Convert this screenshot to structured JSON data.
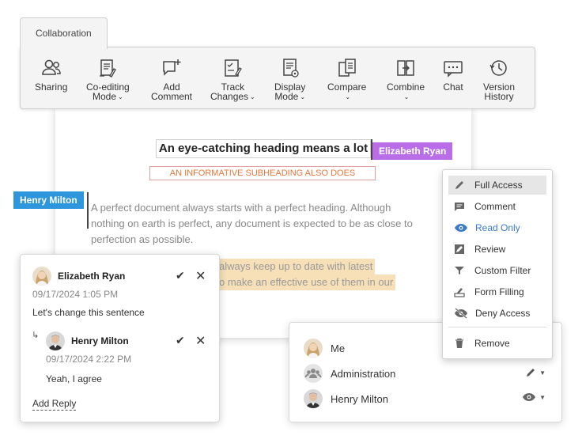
{
  "toolbar": {
    "tab_label": "Collaboration",
    "tools": [
      {
        "icon": "sharing-icon",
        "line1": "Sharing",
        "line2": "",
        "dropdown": false
      },
      {
        "icon": "co-editing-mode-icon",
        "line1": "Co-editing",
        "line2": "Mode",
        "dropdown": true
      },
      {
        "icon": "add-comment-icon",
        "line1": "Add",
        "line2": "Comment",
        "dropdown": false
      },
      {
        "icon": "track-changes-icon",
        "line1": "Track",
        "line2": "Changes",
        "dropdown": true
      },
      {
        "icon": "display-mode-icon",
        "line1": "Display",
        "line2": "Mode",
        "dropdown": true
      },
      {
        "icon": "compare-icon",
        "line1": "Compare",
        "line2": "",
        "dropdown": true
      },
      {
        "icon": "combine-icon",
        "line1": "Combine",
        "line2": "",
        "dropdown": true
      },
      {
        "icon": "chat-icon",
        "line1": "Chat",
        "line2": "",
        "dropdown": false
      },
      {
        "icon": "version-history-icon",
        "line1": "Version",
        "line2": "History",
        "dropdown": false
      }
    ]
  },
  "document": {
    "heading": "An eye-catching heading means a lot",
    "subheading": "AN INFORMATIVE SUBHEADING ALSO DOES",
    "cursor_elizabeth": "Elizabeth Ryan",
    "cursor_henry": "Henry Milton",
    "para_line1": "A perfect  document always starts with a perfect heading. Although",
    "para_line2": "nothing on earth is perfect, any document is expected to be as close to",
    "para_line3": "perfection as possible.",
    "highlight_line1": "always keep up to date with latest",
    "highlight_line2": "o make an effective use of them in our",
    "colors": {
      "elizabeth": "#b96ee8",
      "henry": "#2e96dd",
      "subheading": "#e8763c",
      "highlight": "#f7e0b8"
    }
  },
  "comments": {
    "main": {
      "author": "Elizabeth Ryan",
      "date": "09/17/2024 1:05 PM",
      "text": "Let's change this sentence"
    },
    "reply": {
      "author": "Henry Milton",
      "date": "09/17/2024 2:22 PM",
      "text": "Yeah, I agree"
    },
    "add_reply": "Add Reply"
  },
  "sharing": {
    "users": [
      {
        "name": "Me",
        "avatar": "woman-avatar",
        "permission_icon": ""
      },
      {
        "name": "Administration",
        "avatar": "group-avatar",
        "permission_icon": "pencil-icon"
      },
      {
        "name": "Henry Milton",
        "avatar": "man-avatar",
        "permission_icon": "eye-icon"
      }
    ]
  },
  "permissions_menu": {
    "items": [
      {
        "label": "Full Access",
        "icon": "pencil-icon",
        "selected": true
      },
      {
        "label": "Comment",
        "icon": "comment-icon",
        "selected": false
      },
      {
        "label": "Read Only",
        "icon": "eye-icon",
        "selected": false
      },
      {
        "label": "Review",
        "icon": "review-icon",
        "selected": false
      },
      {
        "label": "Custom Filter",
        "icon": "filter-icon",
        "selected": false
      },
      {
        "label": "Form Filling",
        "icon": "form-filling-icon",
        "selected": false
      },
      {
        "label": "Deny Access",
        "icon": "deny-access-icon",
        "selected": false
      },
      {
        "label": "Remove",
        "icon": "trash-icon",
        "selected": false
      }
    ]
  }
}
